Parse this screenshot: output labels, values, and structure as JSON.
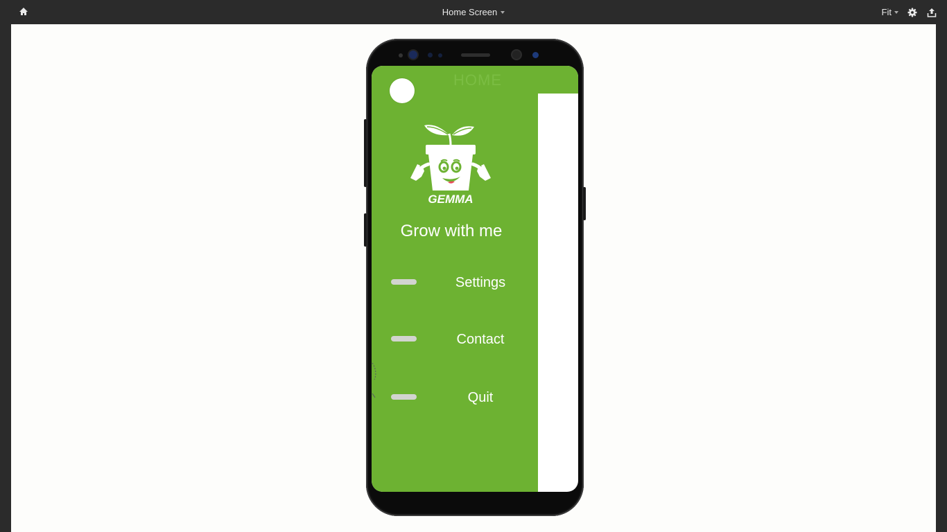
{
  "toolbar": {
    "home_icon": "home-icon",
    "screen_title": "Home Screen",
    "zoom_label": "Fit",
    "settings_icon": "gear-icon",
    "share_icon": "upload-icon"
  },
  "app": {
    "appbar_title": "HOME",
    "brand_name": "GEMMA",
    "tagline": "Grow with me",
    "menu": [
      {
        "label": "Settings"
      },
      {
        "label": "Contact"
      },
      {
        "label": "Quit"
      }
    ],
    "colors": {
      "accent_green": "#6db232",
      "menu_pill": "#d2d4d0",
      "toolbar": "#2b2b2b",
      "canvas": "#fdfdfb"
    }
  }
}
